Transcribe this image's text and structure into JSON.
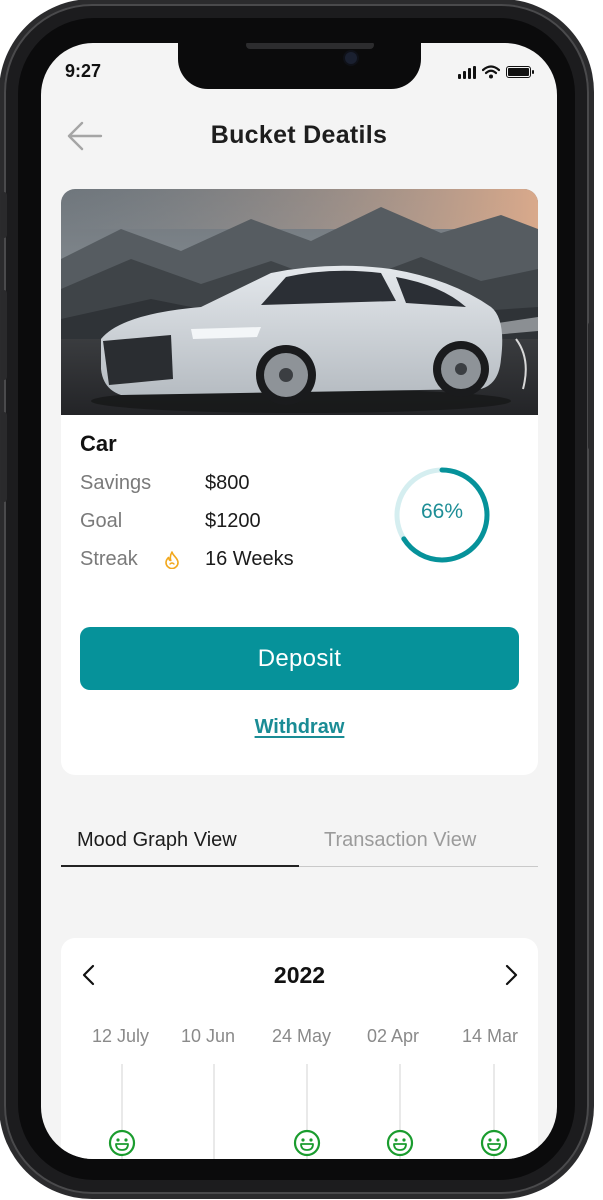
{
  "status_bar": {
    "time": "9:27"
  },
  "header": {
    "title": "Bucket Deatils"
  },
  "bucket": {
    "name": "Car",
    "savings_label": "Savings",
    "savings_value": "$800",
    "goal_label": "Goal",
    "goal_value": "$1200",
    "streak_label": "Streak",
    "streak_value": "16 Weeks",
    "progress_label": "66%",
    "progress_fraction": 0.66,
    "deposit_label": "Deposit",
    "withdraw_label": "Withdraw"
  },
  "tabs": [
    {
      "label": "Mood Graph View",
      "active": true
    },
    {
      "label": "Transaction View",
      "active": false
    }
  ],
  "mood_graph": {
    "year": "2022",
    "dates": [
      "12 July",
      "10 Jun",
      "24 May",
      "02 Apr",
      "14 Mar"
    ],
    "moods": [
      "happy",
      "",
      "happy",
      "happy",
      "happy"
    ]
  },
  "colors": {
    "accent": "#06929a",
    "ring_track": "#d5eef0",
    "mood_green": "#1a9c2e",
    "flame": "#f2a81d"
  },
  "icons": [
    "back-arrow-icon",
    "signal-icon",
    "wifi-icon",
    "battery-icon",
    "flame-icon",
    "chevron-left-icon",
    "chevron-right-icon",
    "smiley-icon"
  ]
}
